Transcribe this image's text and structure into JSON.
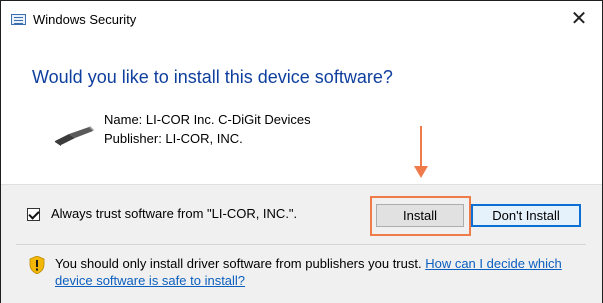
{
  "window": {
    "title": "Windows Security",
    "close_glyph": "✕"
  },
  "main": {
    "heading": "Would you like to install this device software?",
    "name_line": "Name: LI-COR Inc. C-DiGit Devices",
    "publisher_line": "Publisher: LI-COR, INC."
  },
  "footer": {
    "checkbox_label": "Always trust software from \"LI-COR, INC.\".",
    "checkbox_checked": true,
    "install_label": "Install",
    "dont_install_label": "Don't Install",
    "warning_text": "You should only install driver software from publishers you trust. ",
    "warning_link": "How can I decide which device software is safe to install?"
  },
  "colors": {
    "heading": "#0f3f9e",
    "annotation": "#ef7a4a",
    "link": "#0b5fbf",
    "default_button_border": "#0b6fd4"
  },
  "icons": {
    "app": "security-window-icon",
    "device": "usb-device-icon",
    "warning": "shield-warning-icon",
    "annotation": "orange-arrow-icon"
  }
}
